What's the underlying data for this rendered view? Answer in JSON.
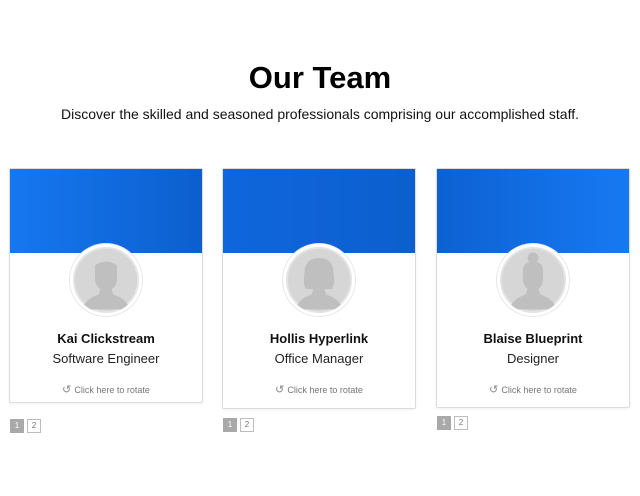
{
  "header": {
    "title": "Our Team",
    "subtitle": "Discover the skilled and seasoned professionals comprising our accomplished staff."
  },
  "colors": {
    "banner_blue": "#1677f0",
    "banner_blue_dark": "#0c5fcd",
    "avatar_gray": "#cccccc",
    "pager_active": "#a9a9a9"
  },
  "cards": [
    {
      "name": "Kai Clickstream",
      "role": "Software Engineer",
      "rotate_label": "Click here to rotate",
      "avatar_icon": "male-silhouette-icon",
      "pages": [
        "1",
        "2"
      ]
    },
    {
      "name": "Hollis Hyperlink",
      "role": "Office Manager",
      "rotate_label": "Click here to rotate",
      "avatar_icon": "female-short-hair-silhouette-icon",
      "pages": [
        "1",
        "2"
      ]
    },
    {
      "name": "Blaise Blueprint",
      "role": "Designer",
      "rotate_label": "Click here to rotate",
      "avatar_icon": "female-bun-silhouette-icon",
      "pages": [
        "1",
        "2"
      ]
    }
  ]
}
